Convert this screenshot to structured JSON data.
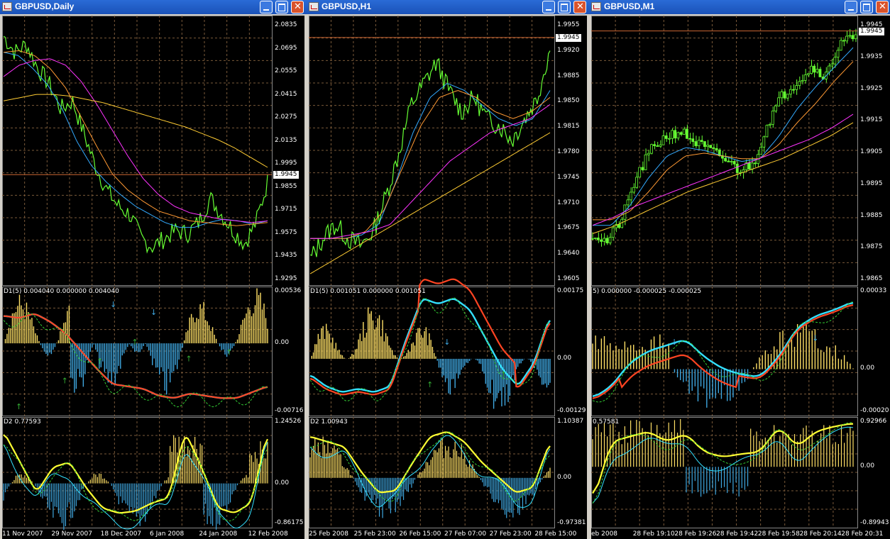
{
  "colors": {
    "grid": "#7a5a3a",
    "price": "#66ff33",
    "ema_fast": "#33aaff",
    "ema_mid": "#ff9933",
    "ema_slow": "#ff33ff",
    "ema_long": "#ffcc33",
    "hist_pos": "#ffe066",
    "hist_neg": "#3fa7e0",
    "signal_cyan": "#33e0ff",
    "signal_red": "#ff4422",
    "d2_yellow": "#ffff33",
    "hline": "#cc6633"
  },
  "windows": [
    {
      "title": "GBPUSD,Daily",
      "price_label": "1.9945",
      "price_ticks": [
        "2.0835",
        "2.0695",
        "2.0555",
        "2.0415",
        "2.0275",
        "2.0135",
        "1.9995",
        "1.9855",
        "1.9715",
        "1.9575",
        "1.9435",
        "1.9295"
      ],
      "d1_header": "D1(5) 0.004040 0.000000 0.004040",
      "d1_ticks": [
        "0.00536",
        "0.00",
        "-0.00716"
      ],
      "d2_header": "D2 0.77593",
      "d2_ticks": [
        "1.24526",
        "0.00",
        "-0.86175"
      ],
      "x_labels": [
        "11 Nov 2007",
        "29 Nov 2007",
        "18 Dec 2007",
        "6 Jan 2008",
        "24 Jan 2008",
        "12 Feb 2008"
      ]
    },
    {
      "title": "GBPUSD,H1",
      "price_label": "1.9945",
      "price_ticks": [
        "1.9955",
        "1.9920",
        "1.9885",
        "1.9850",
        "1.9815",
        "1.9780",
        "1.9745",
        "1.9710",
        "1.9675",
        "1.9640",
        "1.9605"
      ],
      "d1_header": "D1(5) 0.001051 0.000000 0.001051",
      "d1_ticks": [
        "0.00175",
        "0.00",
        "-0.00129"
      ],
      "d2_header": "D2 1.00943",
      "d2_ticks": [
        "1.10387",
        "0.00",
        "-0.97381"
      ],
      "x_labels": [
        "25 Feb 2008",
        "25 Feb 23:00",
        "26 Feb 15:00",
        "27 Feb 07:00",
        "27 Feb 23:00",
        "28 Feb 15:00"
      ]
    },
    {
      "title": "GBPUSD,M1",
      "price_label": "1.9945",
      "price_ticks": [
        "1.9945",
        "1.9935",
        "1.9925",
        "1.9915",
        "1.9905",
        "1.9895",
        "1.9885",
        "1.9875",
        "1.9865"
      ],
      "d1_header": "5) 0.000000 -0.000025 -0.000025",
      "d1_ticks": [
        "0.00033",
        "0.00",
        "-0.00020"
      ],
      "d2_header": "0.57581",
      "d2_ticks": [
        "0.92966",
        "0.00",
        "-0.89943"
      ],
      "x_labels": [
        "eb 2008",
        "28 Feb 19:10",
        "28 Feb 19:26",
        "28 Feb 19:42",
        "28 Feb 19:58",
        "28 Feb 20:14",
        "28 Feb 20:31"
      ]
    }
  ],
  "chart_data": [
    {
      "type": "line",
      "window": "GBPUSD,Daily",
      "series": [
        {
          "values": [
            2.08,
            2.07,
            2.065,
            2.06,
            2.058,
            2.07,
            2.06,
            2.05,
            2.045,
            2.035,
            2.04,
            2.03,
            2.02,
            2.01,
            2.0,
            1.99,
            1.985,
            1.98,
            1.975,
            1.97,
            1.96,
            1.955,
            1.95,
            1.955,
            1.96,
            1.952,
            1.948,
            1.955,
            1.96,
            1.965,
            1.97,
            1.975,
            1.985,
            1.965,
            1.955,
            1.97,
            1.96,
            1.95,
            1.96,
            1.975,
            1.99
          ]
        },
        {
          "values": [
            2.07,
            2.068,
            2.065,
            2.062,
            2.06,
            2.058,
            2.055,
            2.05,
            2.045,
            2.04,
            2.035,
            2.03,
            2.02,
            2.01,
            2.0,
            1.995,
            1.99,
            1.985,
            1.98,
            1.975,
            1.97,
            1.968,
            1.965,
            1.963,
            1.962,
            1.962,
            1.962,
            1.963,
            1.964,
            1.965,
            1.966,
            1.967,
            1.968,
            1.967,
            1.966,
            1.966,
            1.965,
            1.964,
            1.964,
            1.965,
            1.967
          ]
        },
        {
          "values": [
            2.06,
            2.062,
            2.064,
            2.065,
            2.066,
            2.066,
            2.065,
            2.062,
            2.058,
            2.052,
            2.045,
            2.038,
            2.03,
            2.022,
            2.014,
            2.006,
            1.998,
            1.99,
            1.985,
            1.98,
            1.977,
            1.975,
            1.973,
            1.972,
            1.971,
            1.97,
            1.97,
            1.97,
            1.969,
            1.968,
            1.967,
            1.966,
            1.966,
            1.965,
            1.965,
            1.964,
            1.964,
            1.964,
            1.964,
            1.965,
            1.966
          ]
        },
        {
          "values": [
            2.04,
            2.041,
            2.042,
            2.043,
            2.043,
            2.044,
            2.044,
            2.044,
            2.044,
            2.044,
            2.043,
            2.042,
            2.041,
            2.04,
            2.039,
            2.038,
            2.037,
            2.036,
            2.035,
            2.034,
            2.033,
            2.032,
            2.031,
            2.03,
            2.029,
            2.028,
            2.027,
            2.026,
            2.025,
            2.024,
            2.023,
            2.022,
            2.021,
            2.02,
            2.019,
            2.017,
            2.015,
            2.013,
            2.011,
            2.008,
            2.005
          ]
        }
      ]
    }
  ]
}
